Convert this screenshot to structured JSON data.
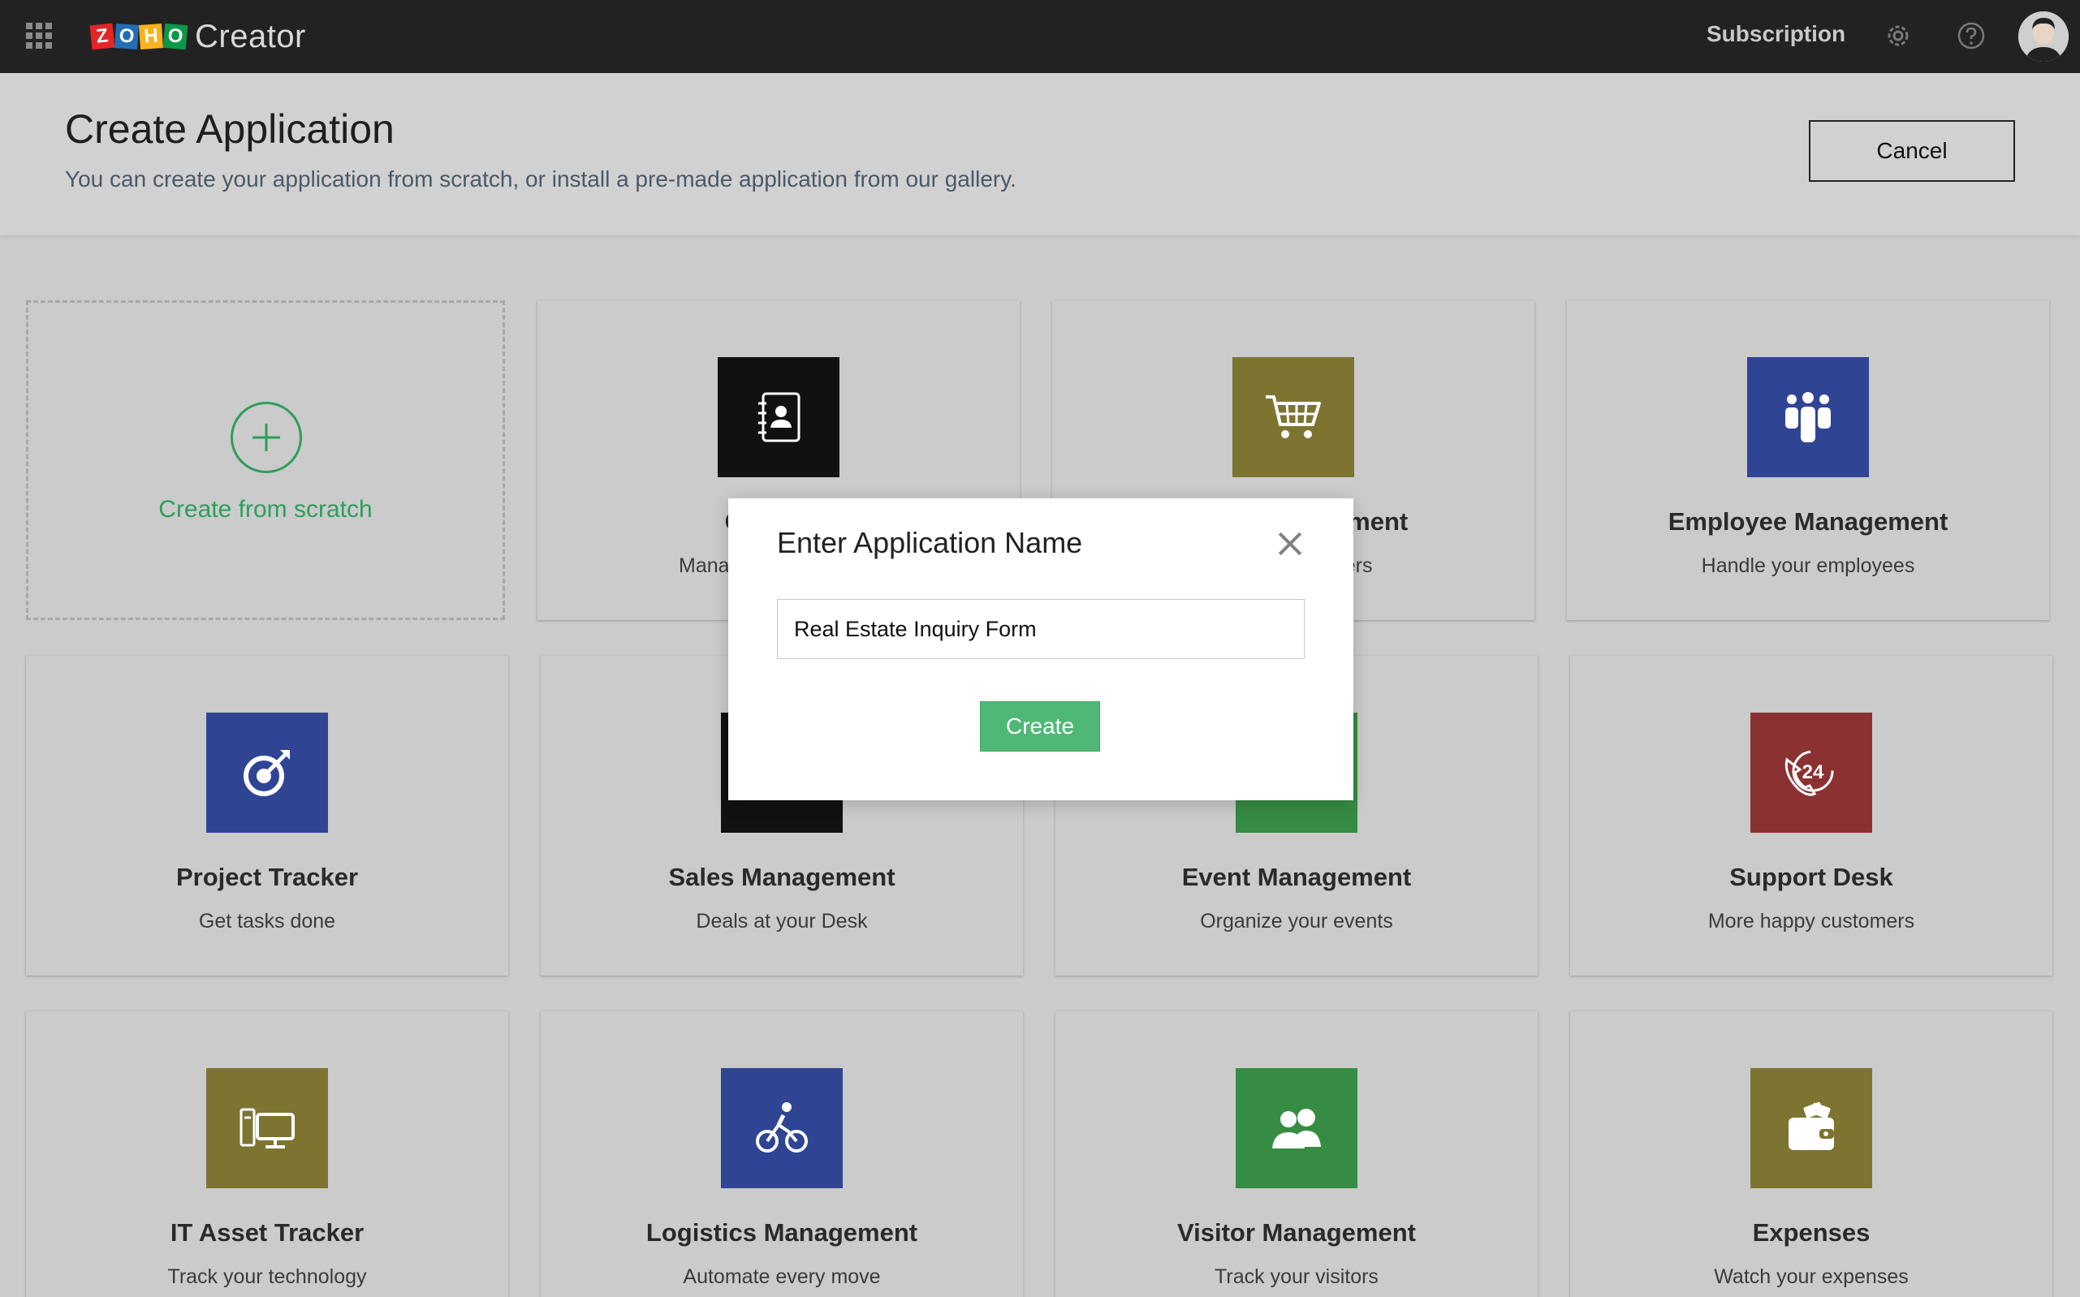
{
  "topbar": {
    "logo_letters": [
      "Z",
      "O",
      "H",
      "O"
    ],
    "logo_colors": [
      "#e42527",
      "#226db4",
      "#f9b21d",
      "#089949"
    ],
    "product_name": "Creator",
    "subscription_label": "Subscription",
    "icons": [
      "apps-grid-icon",
      "gear-icon",
      "help-icon",
      "avatar"
    ]
  },
  "header": {
    "title": "Create Application",
    "subtitle": "You can create your application from scratch, or install a pre-made application from our gallery.",
    "cancel_label": "Cancel"
  },
  "scratch": {
    "label": "Create from scratch",
    "accent": "#2e9e5c"
  },
  "gallery": [
    {
      "title": "Contacts",
      "desc": "Manage your contacts",
      "color": "#111111",
      "icon": "contacts-book-icon"
    },
    {
      "title": "Order Management",
      "desc": "Track your orders",
      "color": "#7d7431",
      "icon": "shopping-cart-icon"
    },
    {
      "title": "Employee Management",
      "desc": "Handle your employees",
      "color": "#2f4594",
      "icon": "team-icon"
    },
    {
      "title": "Project Tracker",
      "desc": "Get tasks done",
      "color": "#2f4594",
      "icon": "target-icon"
    },
    {
      "title": "Sales Management",
      "desc": "Deals at your Desk",
      "color": "#111111",
      "icon": "handshake-icon"
    },
    {
      "title": "Event Management",
      "desc": "Organize your events",
      "color": "#368c43",
      "icon": "calendar-icon"
    },
    {
      "title": "Support Desk",
      "desc": "More happy customers",
      "color": "#8c3131",
      "icon": "support-24-icon"
    },
    {
      "title": "IT Asset Tracker",
      "desc": "Track your technology",
      "color": "#7d7431",
      "icon": "computer-icon"
    },
    {
      "title": "Logistics Management",
      "desc": "Automate every move",
      "color": "#2f4594",
      "icon": "cyclist-icon"
    },
    {
      "title": "Visitor Management",
      "desc": "Track your visitors",
      "color": "#368c43",
      "icon": "visitors-icon"
    },
    {
      "title": "Expenses",
      "desc": "Watch your expenses",
      "color": "#7d7431",
      "icon": "wallet-icon"
    }
  ],
  "modal": {
    "title": "Enter Application Name",
    "input_value": "Real Estate Inquiry Form",
    "create_label": "Create",
    "button_color": "#4fb876"
  }
}
